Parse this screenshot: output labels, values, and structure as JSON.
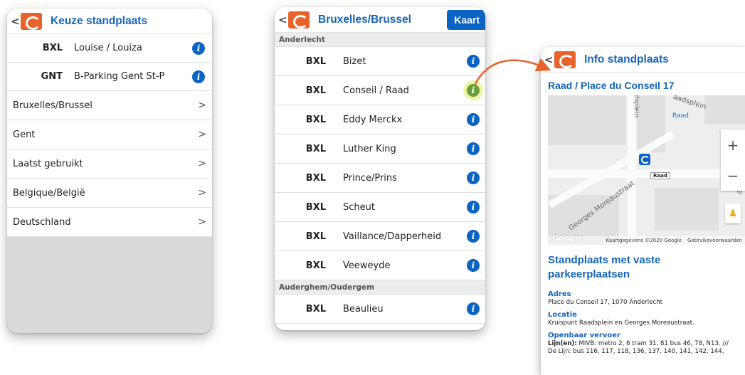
{
  "screen1": {
    "title": "Keuze standplaats",
    "favorites": [
      {
        "code": "BXL",
        "name": "Louise / Louiza"
      },
      {
        "code": "GNT",
        "name": "B-Parking Gent St-P"
      }
    ],
    "nav_items": [
      "Bruxelles/Brussel",
      "Gent",
      "Laatst gebruikt",
      "Belgique/België",
      "Deutschland"
    ]
  },
  "screen2": {
    "title": "Bruxelles/Brussel",
    "map_button": "Kaart",
    "sections": [
      {
        "name": "Anderlecht",
        "rows": [
          {
            "code": "BXL",
            "name": "Bizet"
          },
          {
            "code": "BXL",
            "name": "Conseil / Raad",
            "highlighted": true
          },
          {
            "code": "BXL",
            "name": "Eddy Merckx"
          },
          {
            "code": "BXL",
            "name": "Luther King"
          },
          {
            "code": "BXL",
            "name": "Prince/Prins"
          },
          {
            "code": "BXL",
            "name": "Scheut"
          },
          {
            "code": "BXL",
            "name": "Vaillance/Dapperheid"
          },
          {
            "code": "BXL",
            "name": "Veeweyde"
          }
        ]
      },
      {
        "name": "Auderghem/Oudergem",
        "rows": [
          {
            "code": "BXL",
            "name": "Beaulieu"
          }
        ]
      }
    ]
  },
  "screen3": {
    "title": "Info standplaats",
    "place_title": "Raad / Place du Conseil 17",
    "map": {
      "labels": {
        "street1": "dsplein",
        "street2": "aadsplein",
        "station": "Raad",
        "street3": "Georges Moreaustraat",
        "road": "Raad",
        "ro": "Ro"
      },
      "credits": "Kaartgegevens ©2020 Google",
      "terms": "Gebruiksvoorwaarden",
      "google": "Google",
      "zoom_in": "+",
      "zoom_out": "−"
    },
    "type": "Standplaats met vaste parkeerplaatsen",
    "address_label": "Adres",
    "address": "Place du Conseil 17, 1070 Anderlecht",
    "location_label": "Locatie",
    "location": "Kruispunt Raadsplein en Georges Moreaustraat.",
    "transport_label": "Openbaar vervoer",
    "transport_prefix": "Lijn(en):",
    "transport": "MIVB: metro 2, 6 tram 31, 81 bus 46, 78, N13. /// De Lijn: bus 116, 117, 118, 136, 137, 140, 141, 142, 144,"
  },
  "colors": {
    "accent": "#1565b8",
    "brand": "#e8632b",
    "info": "#0b63c4",
    "highlight": "#eef5a5"
  }
}
